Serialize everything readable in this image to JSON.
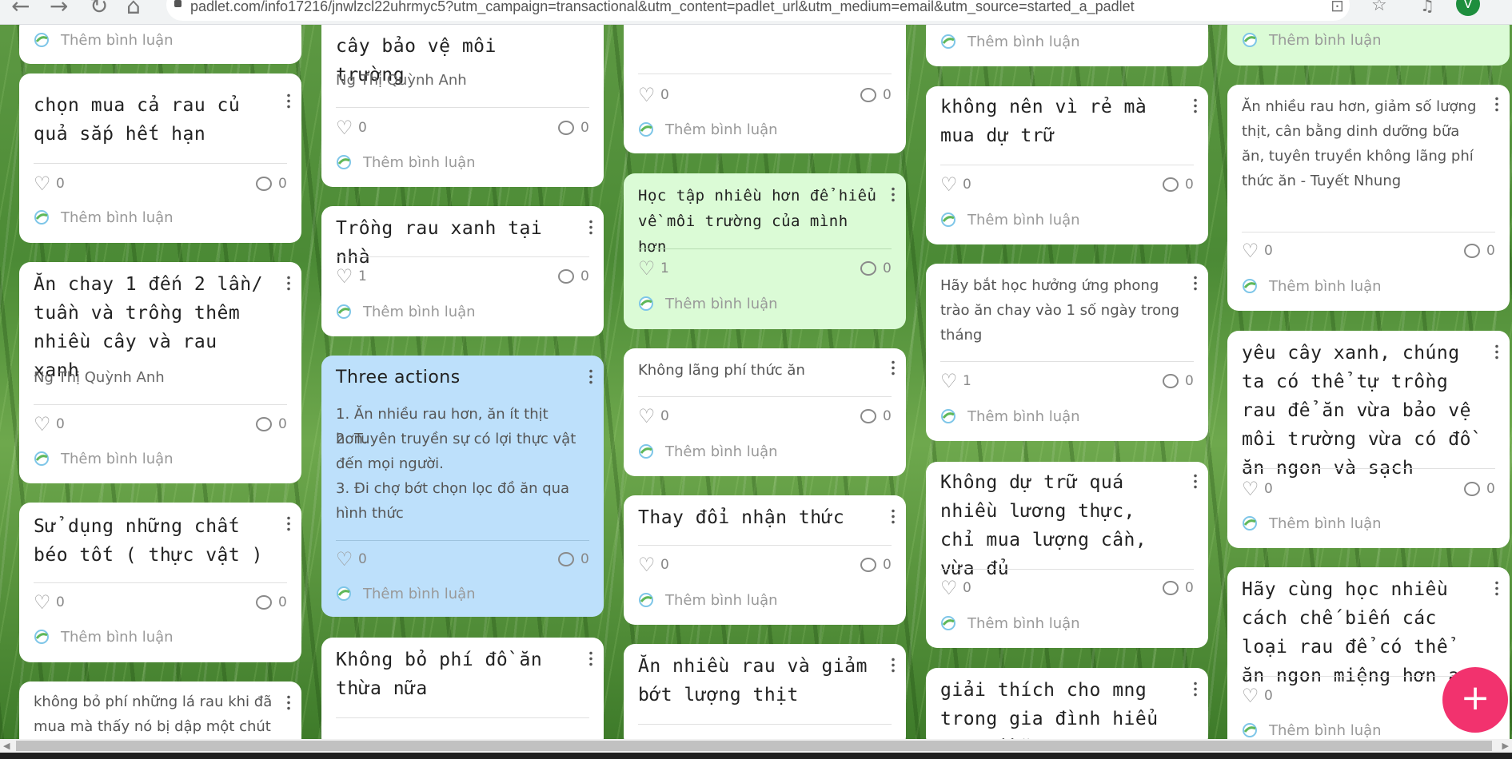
{
  "browser": {
    "url": "padlet.com/info17216/jnwlzcl22uhrmyc5?utm_campaign=transactional&utm_content=padlet_url&utm_medium=email&utm_source=started_a_padlet",
    "avatar_letter": "V"
  },
  "comment_label": "Thêm bình luận",
  "cards": [
    {
      "title": "",
      "likes": "",
      "comments": ""
    },
    {
      "title": "chọn mua cả rau củ quả sắp hết hạn",
      "likes": "0",
      "comments": "0"
    },
    {
      "title": "Ăn chay 1 đến 2 lần/ tuần và trồng thêm nhiều cây và rau xanh",
      "author": "Ng Thị Quỳnh Anh",
      "likes": "0",
      "comments": "0"
    },
    {
      "title": "Sử dụng những chất béo tốt ( thực vật )",
      "likes": "0",
      "comments": "0"
    },
    {
      "body": "không bỏ phí những lá rau khi đã mua mà thấy nó bị dập một chút"
    },
    {
      "title": "cây bảo vệ môi trường",
      "author": "Ng Thị Quỳnh Anh",
      "likes": "0",
      "comments": "0"
    },
    {
      "title": "Trồng rau xanh tại nhà",
      "likes": "1",
      "comments": "0"
    },
    {
      "title": "Three actions",
      "body_lines": [
        "1. Ăn nhiều rau hơn, ăn ít thịt hơn.",
        "2. Tuyên truyền sự có lợi thực vật đến mọi người.",
        "3. Đi chợ bớt chọn lọc đồ ăn qua hình thức"
      ],
      "likes": "0",
      "comments": "0"
    },
    {
      "title": "Không bỏ phí đồ ăn thừa nữa"
    },
    {
      "likes": "0",
      "comments": "0"
    },
    {
      "title": "Học tập nhiều hơn để hiểu về môi trường của mình hơn",
      "likes": "1",
      "comments": "0"
    },
    {
      "body": "Không lãng phí thức ăn",
      "likes": "0",
      "comments": "0"
    },
    {
      "title": "Thay đổi nhận thức",
      "likes": "0",
      "comments": "0"
    },
    {
      "title": "Ăn nhiều rau và giảm bớt lượng thịt"
    },
    {
      "title": "không nên vì rẻ mà mua dự trữ",
      "likes": "0",
      "comments": "0"
    },
    {
      "body": "Hãy bắt học hưởng ứng phong trào ăn chay vào 1 số ngày trong tháng",
      "likes": "1",
      "comments": "0"
    },
    {
      "title": "Không dự trữ quá nhiều lương thực, chỉ mua lượng cần, vừa đủ",
      "likes": "0",
      "comments": "0"
    },
    {
      "title": "giải thích cho mng trong gia đình hiểu hơn về ăn"
    },
    {
      "body": "Ăn nhiều rau hơn, giảm số lượng thịt, cân bằng dinh dưỡng bữa ăn, tuyên truyền không lãng phí thức ăn - Tuyết Nhung",
      "likes": "0",
      "comments": "0"
    },
    {
      "title": "yêu cây xanh, chúng ta có thể tự trồng rau để ăn vừa bảo vệ môi trường vừa có đồ ăn ngon và sạch",
      "likes": "0",
      "comments": "0"
    },
    {
      "title": "Hãy cùng học nhiều cách chế biến các loại rau để có thể ăn ngon miệng hơn ạ",
      "likes": "0"
    }
  ],
  "fab_label": "+"
}
